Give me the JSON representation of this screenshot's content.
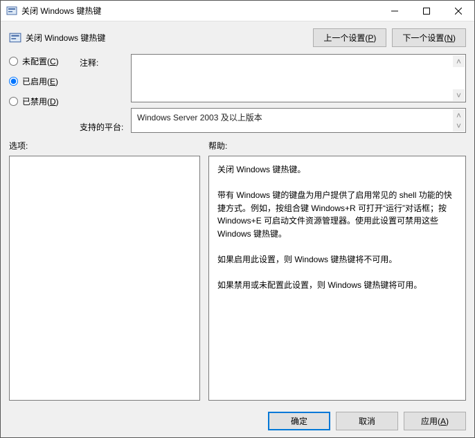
{
  "window": {
    "title": "关闭 Windows 键热键"
  },
  "header": {
    "policy_label": "关闭 Windows 键热键"
  },
  "nav": {
    "prev": "上一个设置(P)",
    "next": "下一个设置(N)"
  },
  "radios": {
    "not_configured": "未配置(C)",
    "enabled": "已启用(E)",
    "disabled": "已禁用(D)",
    "selected": "enabled"
  },
  "labels": {
    "comment": "注释:",
    "platform": "支持的平台:",
    "options": "选项:",
    "help": "帮助:"
  },
  "fields": {
    "comment": "",
    "platform": "Windows Server 2003 及以上版本"
  },
  "help_text": "关闭 Windows 键热键。\n\n带有 Windows 键的键盘为用户提供了启用常见的 shell 功能的快捷方式。例如，按组合键 Windows+R 可打开“运行”对话框；按 Windows+E 可启动文件资源管理器。使用此设置可禁用这些 Windows 键热键。\n\n如果启用此设置，则 Windows 键热键将不可用。\n\n如果禁用或未配置此设置，则 Windows 键热键将可用。",
  "footer": {
    "ok": "确定",
    "cancel": "取消",
    "apply": "应用(A)"
  }
}
